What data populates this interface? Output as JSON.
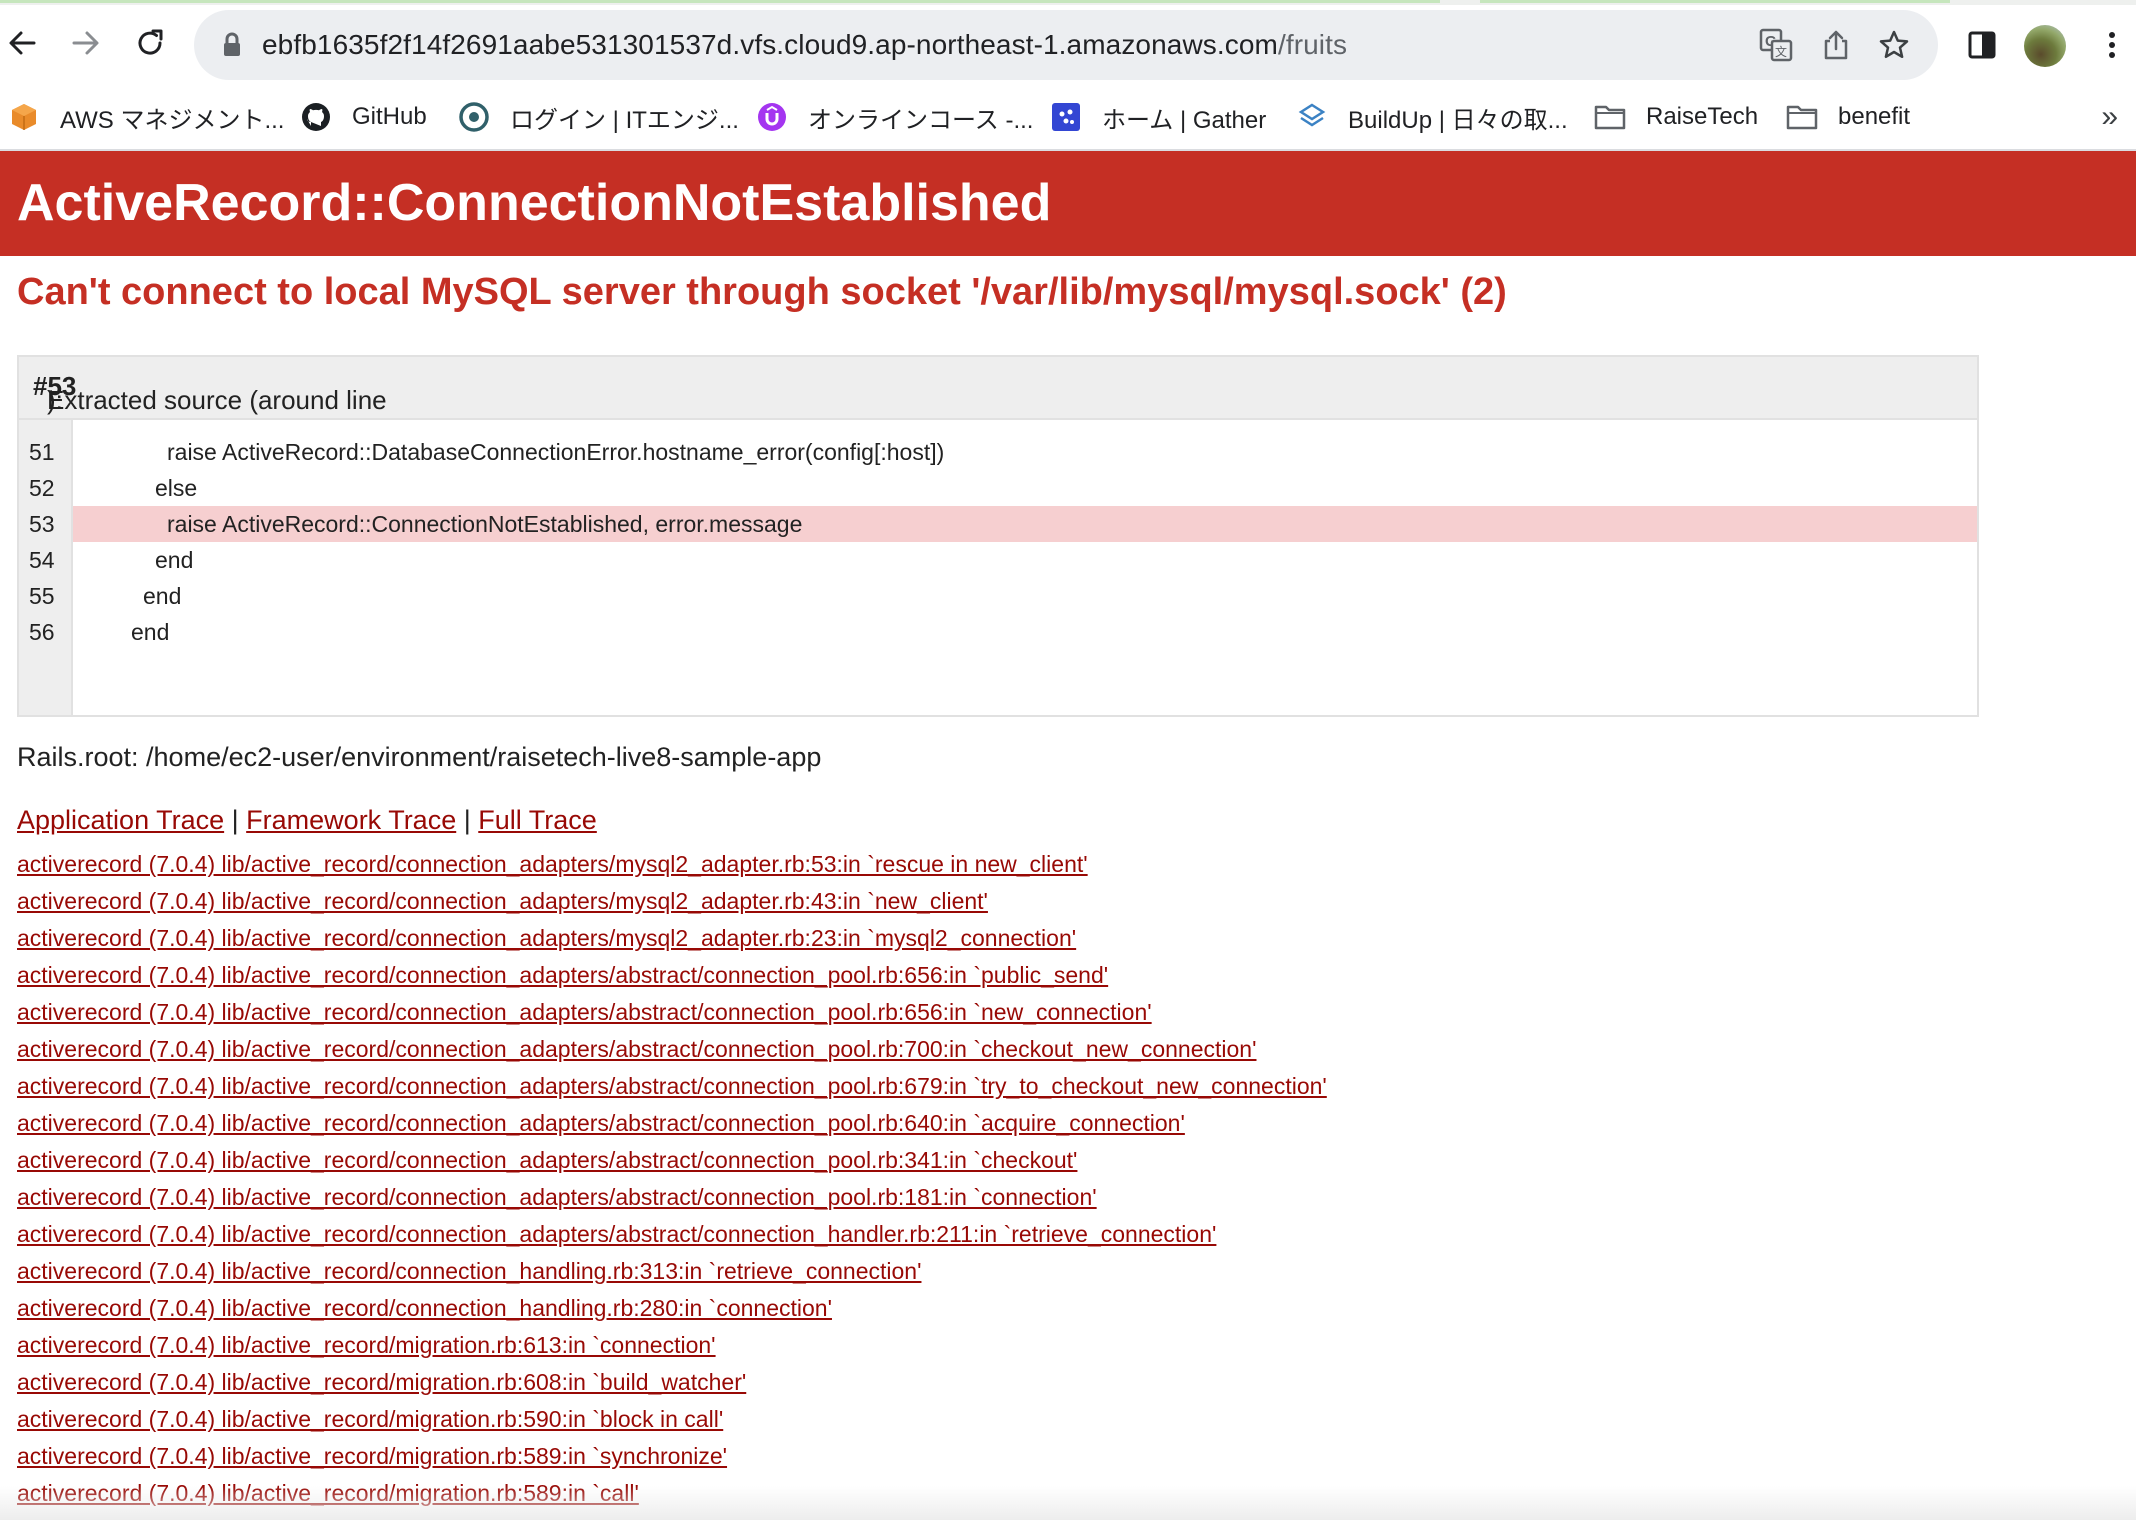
{
  "browser": {
    "url_host": "ebfb1635f2f14f2691aabe531301537d.vfs.cloud9.ap-northeast-1.amazonaws.com",
    "url_path": "/fruits",
    "bookmarks": [
      {
        "label": "AWS マネジメント...",
        "icon": "aws-cube-icon"
      },
      {
        "label": "GitHub",
        "icon": "github-icon"
      },
      {
        "label": "ログイン | ITエンジ...",
        "icon": "circle-logo-icon"
      },
      {
        "label": "オンラインコース -...",
        "icon": "udemy-icon"
      },
      {
        "label": "ホーム | Gather",
        "icon": "gather-icon"
      },
      {
        "label": "BuildUp | 日々の取...",
        "icon": "buildup-icon"
      },
      {
        "label": "RaiseTech",
        "icon": "folder-icon"
      },
      {
        "label": "benefit",
        "icon": "folder-icon"
      }
    ],
    "more_bookmarks": "»"
  },
  "error": {
    "title": "ActiveRecord::ConnectionNotEstablished",
    "message": "Can't connect to local MySQL server through socket '/var/lib/mysql/mysql.sock' (2)"
  },
  "source": {
    "heading_prefix": "Extracted source (around line ",
    "heading_line": "#53",
    "heading_suffix": "):",
    "lines": [
      {
        "no": "51",
        "code": "raise ActiveRecord::DatabaseConnectionError.hostname_error(config[:host])",
        "highlighted": false
      },
      {
        "no": "52",
        "code": "else",
        "highlighted": false
      },
      {
        "no": "53",
        "code": "raise ActiveRecord::ConnectionNotEstablished, error.message",
        "highlighted": true
      },
      {
        "no": "54",
        "code": "end",
        "highlighted": false
      },
      {
        "no": "55",
        "code": "end",
        "highlighted": false
      },
      {
        "no": "56",
        "code": "end",
        "highlighted": false
      }
    ]
  },
  "rails_root": "Rails.root: /home/ec2-user/environment/raisetech-live8-sample-app",
  "trace_tabs": {
    "application": "Application Trace",
    "framework": "Framework Trace",
    "full": "Full Trace",
    "separator": "|"
  },
  "trace": [
    "activerecord (7.0.4) lib/active_record/connection_adapters/mysql2_adapter.rb:53:in `rescue in new_client'",
    "activerecord (7.0.4) lib/active_record/connection_adapters/mysql2_adapter.rb:43:in `new_client'",
    "activerecord (7.0.4) lib/active_record/connection_adapters/mysql2_adapter.rb:23:in `mysql2_connection'",
    "activerecord (7.0.4) lib/active_record/connection_adapters/abstract/connection_pool.rb:656:in `public_send'",
    "activerecord (7.0.4) lib/active_record/connection_adapters/abstract/connection_pool.rb:656:in `new_connection'",
    "activerecord (7.0.4) lib/active_record/connection_adapters/abstract/connection_pool.rb:700:in `checkout_new_connection'",
    "activerecord (7.0.4) lib/active_record/connection_adapters/abstract/connection_pool.rb:679:in `try_to_checkout_new_connection'",
    "activerecord (7.0.4) lib/active_record/connection_adapters/abstract/connection_pool.rb:640:in `acquire_connection'",
    "activerecord (7.0.4) lib/active_record/connection_adapters/abstract/connection_pool.rb:341:in `checkout'",
    "activerecord (7.0.4) lib/active_record/connection_adapters/abstract/connection_pool.rb:181:in `connection'",
    "activerecord (7.0.4) lib/active_record/connection_adapters/abstract/connection_handler.rb:211:in `retrieve_connection'",
    "activerecord (7.0.4) lib/active_record/connection_handling.rb:313:in `retrieve_connection'",
    "activerecord (7.0.4) lib/active_record/connection_handling.rb:280:in `connection'",
    "activerecord (7.0.4) lib/active_record/migration.rb:613:in `connection'",
    "activerecord (7.0.4) lib/active_record/migration.rb:608:in `build_watcher'",
    "activerecord (7.0.4) lib/active_record/migration.rb:590:in `block in call'",
    "activerecord (7.0.4) lib/active_record/migration.rb:589:in `synchronize'",
    "activerecord (7.0.4) lib/active_record/migration.rb:589:in `call'"
  ]
}
